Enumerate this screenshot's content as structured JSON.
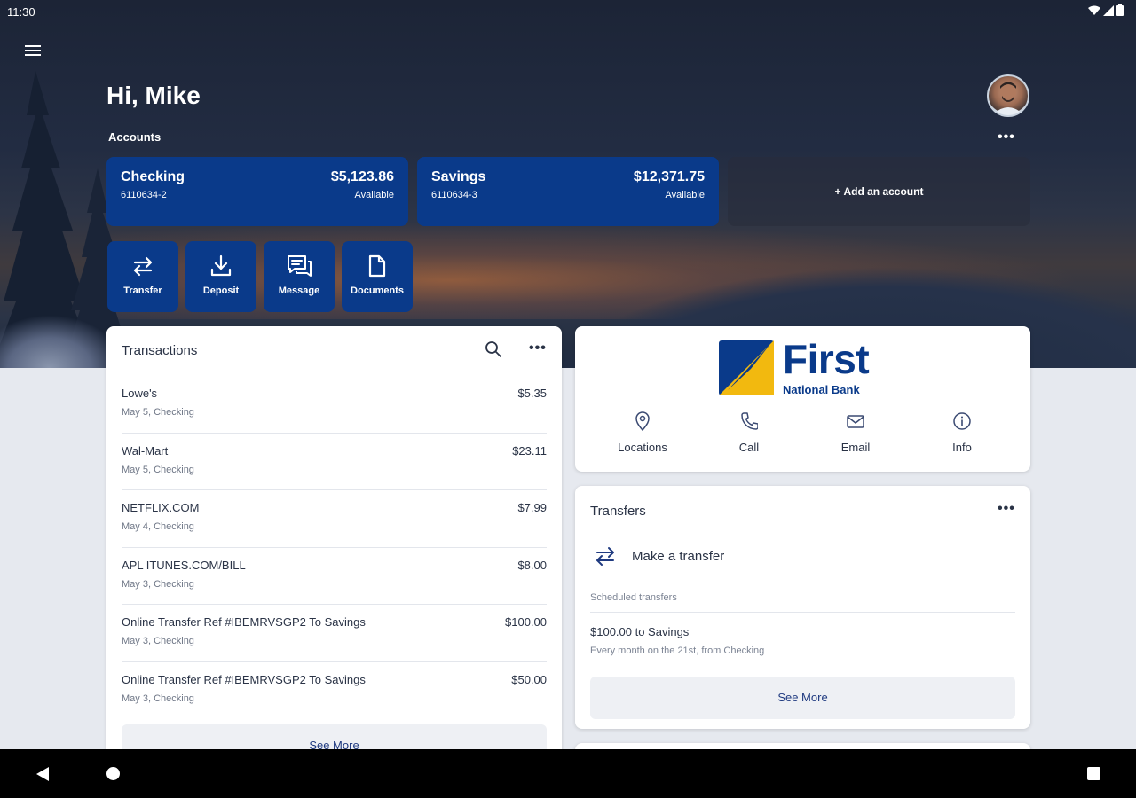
{
  "status": {
    "time": "11:30"
  },
  "header": {
    "greeting": "Hi, Mike",
    "accounts_label": "Accounts",
    "more": "•••"
  },
  "accounts": [
    {
      "name": "Checking",
      "number": "6110634-2",
      "balance": "$5,123.86",
      "status": "Available"
    },
    {
      "name": "Savings",
      "number": "6110634-3",
      "balance": "$12,371.75",
      "status": "Available"
    }
  ],
  "add_account": "+ Add an account",
  "actions": [
    {
      "label": "Transfer",
      "icon": "transfer-icon"
    },
    {
      "label": "Deposit",
      "icon": "deposit-icon"
    },
    {
      "label": "Message",
      "icon": "message-icon"
    },
    {
      "label": "Documents",
      "icon": "document-icon"
    }
  ],
  "transactions": {
    "title": "Transactions",
    "more": "•••",
    "items": [
      {
        "merchant": "Lowe's",
        "detail": "May 5, Checking",
        "amount": "$5.35"
      },
      {
        "merchant": "Wal-Mart",
        "detail": "May 5, Checking",
        "amount": "$23.11"
      },
      {
        "merchant": "NETFLIX.COM",
        "detail": "May 4, Checking",
        "amount": "$7.99"
      },
      {
        "merchant": "APL ITUNES.COM/BILL",
        "detail": "May 3, Checking",
        "amount": "$8.00"
      },
      {
        "merchant": "Online Transfer Ref #IBEMRVSGP2 To Savings",
        "detail": "May 3, Checking",
        "amount": "$100.00"
      },
      {
        "merchant": "Online Transfer Ref #IBEMRVSGP2 To Savings",
        "detail": "May 3, Checking",
        "amount": "$50.00"
      }
    ],
    "see_more": "See More"
  },
  "bank": {
    "logo_first": "First",
    "logo_sub": "National Bank",
    "brand_blue": "#0a3a8a",
    "brand_gold": "#f2b90f",
    "actions": [
      {
        "label": "Locations",
        "icon": "location-pin-icon"
      },
      {
        "label": "Call",
        "icon": "phone-icon"
      },
      {
        "label": "Email",
        "icon": "email-icon"
      },
      {
        "label": "Info",
        "icon": "info-icon"
      }
    ]
  },
  "transfers": {
    "title": "Transfers",
    "more": "•••",
    "make": "Make a transfer",
    "scheduled_label": "Scheduled transfers",
    "scheduled": [
      {
        "title": "$100.00 to Savings",
        "detail": "Every month on the 21st, from Checking"
      }
    ],
    "see_more": "See More"
  }
}
